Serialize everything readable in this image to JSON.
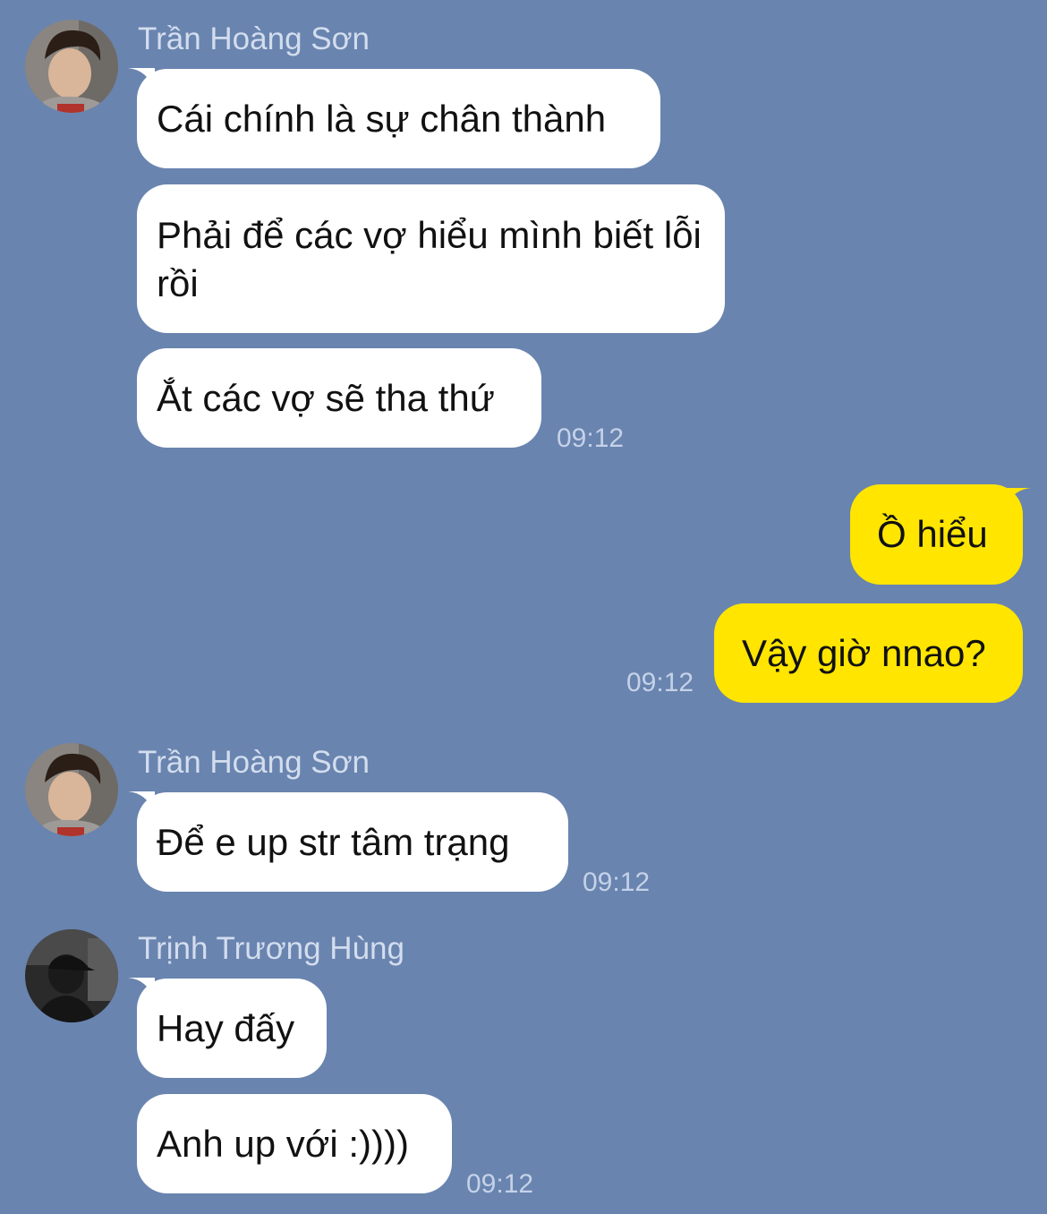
{
  "colors": {
    "background": "#6984AF",
    "incoming_bubble": "#FFFFFF",
    "outgoing_bubble": "#FFE500",
    "sender_name": "#D3DDEE",
    "timestamp": "#C5D2E8"
  },
  "groups": [
    {
      "sender": "Trần Hoàng Sơn",
      "avatar": "avatar-photo",
      "messages": [
        "Cái chính là sự chân thành",
        "Phải để các vợ hiểu mình biết lỗi rồi",
        "Ắt các vợ sẽ tha thứ"
      ],
      "time": "09:12"
    },
    {
      "sender": "",
      "outgoing": true,
      "messages": [
        "Ồ hiểu",
        "Vậy giờ nnao?"
      ],
      "time": "09:12"
    },
    {
      "sender": "Trần Hoàng Sơn",
      "avatar": "avatar-photo",
      "messages": [
        "Để e up str tâm trạng"
      ],
      "time": "09:12"
    },
    {
      "sender": "Trịnh Trương Hùng",
      "avatar": "avatar-photo-dark",
      "messages": [
        "Hay đấy",
        "Anh up với :))))"
      ],
      "time": "09:12"
    }
  ]
}
